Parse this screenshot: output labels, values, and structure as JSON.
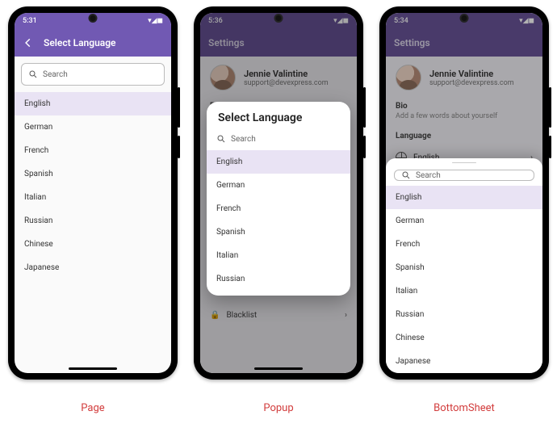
{
  "status_times": {
    "page": "5:31",
    "popup": "5:36",
    "sheet": "5:34"
  },
  "select_language_title": "Select Language",
  "search_placeholder": "Search",
  "languages_full": [
    "English",
    "German",
    "French",
    "Spanish",
    "Italian",
    "Russian",
    "Chinese",
    "Japanese"
  ],
  "languages_popup": [
    "English",
    "German",
    "French",
    "Spanish",
    "Italian",
    "Russian"
  ],
  "selected_language": "English",
  "settings": {
    "title": "Settings",
    "profile_name": "Jennie Valintine",
    "profile_email": "support@devexpress.com",
    "bio_label": "Bio",
    "bio_placeholder": "Add a few words about yourself",
    "language_label": "Language",
    "language_value": "English",
    "blacklist_label": "Blacklist"
  },
  "captions": {
    "page": "Page",
    "popup": "Popup",
    "sheet": "BottomSheet"
  }
}
